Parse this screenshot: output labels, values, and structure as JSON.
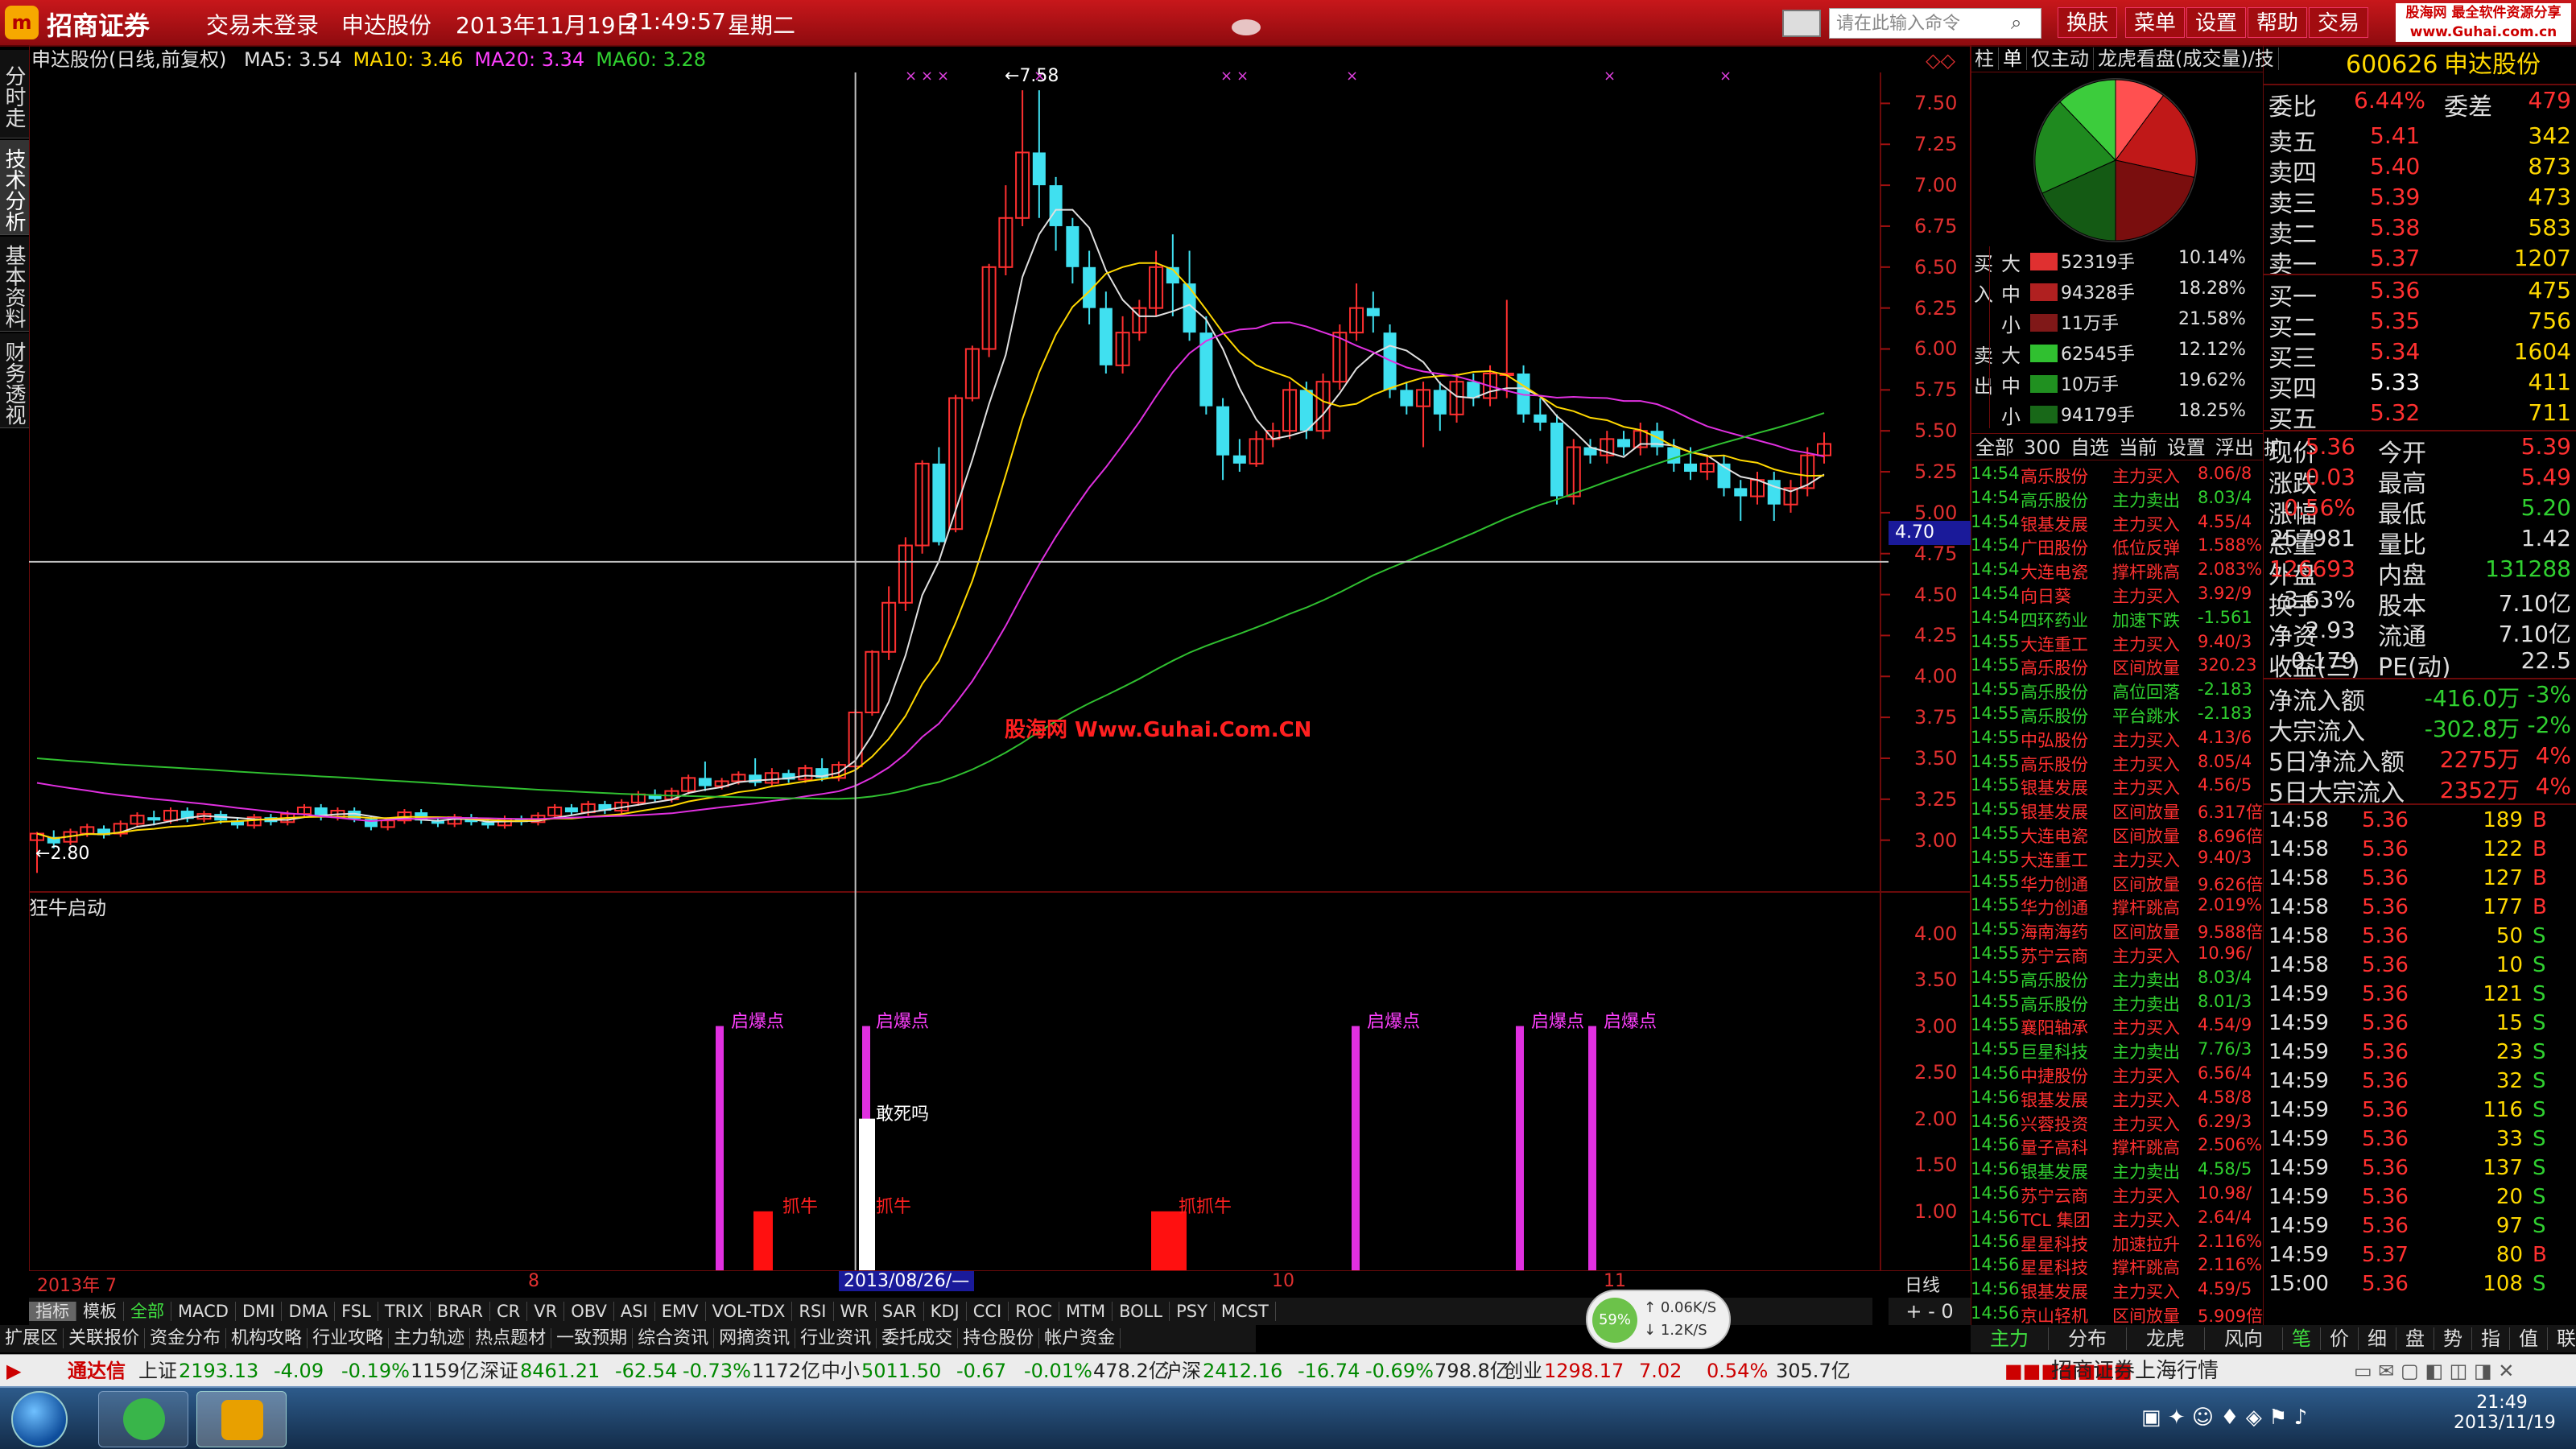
{
  "app": {
    "brand": "招商证券",
    "login_status": "交易未登录",
    "stock_name": "申达股份",
    "date": "2013年11月19日",
    "time": "21:49:57",
    "weekday": "星期二",
    "cmd_placeholder": "请在此输入命令",
    "menus": [
      "换肤",
      "菜单",
      "设置",
      "帮助",
      "交易"
    ],
    "site_badge_1": "股海网 最全软件资源分享",
    "site_badge_2": "www.Guhai.com.cn"
  },
  "side_tabs": [
    "分时走势",
    "技术分析",
    "基本资料",
    "财务透视"
  ],
  "chart": {
    "title": "申达股份(日线,前复权)",
    "ma_labels": [
      {
        "t": "MA5: 3.54",
        "c": "#e0e0e0"
      },
      {
        "t": "MA10: 3.46",
        "c": "#ffd800"
      },
      {
        "t": "MA20: 3.34",
        "c": "#ff40ff"
      },
      {
        "t": "MA60: 3.28",
        "c": "#30d030"
      }
    ],
    "y_ticks": [
      "7.50",
      "7.25",
      "7.00",
      "6.75",
      "6.50",
      "6.25",
      "6.00",
      "5.75",
      "5.50",
      "5.25",
      "5.00",
      "4.75",
      "4.50",
      "4.25",
      "4.00",
      "3.75",
      "3.50",
      "3.25",
      "3.00"
    ],
    "high_label": "7.58",
    "low_label": "2.80",
    "cursor_price": "4.70",
    "watermark": "股海网 Www.Guhai.Com.CN",
    "x_labels": [
      "2013年 7",
      "8",
      "10",
      "11"
    ],
    "cursor_date": "2013/08/26/—",
    "period": "日线"
  },
  "indicator": {
    "name": "狂牛启动",
    "y_ticks": [
      "4.00",
      "3.50",
      "3.00",
      "2.50",
      "2.00",
      "1.50",
      "1.00"
    ],
    "labels": [
      {
        "t": "启爆点",
        "k": "qbd"
      },
      {
        "t": "启爆点",
        "k": "qbd"
      },
      {
        "t": "启爆点",
        "k": "qbd"
      },
      {
        "t": "启爆点",
        "k": "qbd"
      },
      {
        "t": "启爆点",
        "k": "qbd"
      },
      {
        "t": "抓牛",
        "k": "zn"
      },
      {
        "t": "抓牛",
        "k": "zn"
      },
      {
        "t": "抓抓牛",
        "k": "zn"
      },
      {
        "t": "敢死吗",
        "k": "gsm"
      }
    ]
  },
  "indicator_tabs": [
    "指标",
    "模板",
    "全部",
    "MACD",
    "DMI",
    "DMA",
    "FSL",
    "TRIX",
    "BRAR",
    "CR",
    "VR",
    "OBV",
    "ASI",
    "EMV",
    "VOL-TDX",
    "RSI",
    "WR",
    "SAR",
    "KDJ",
    "CCI",
    "ROC",
    "MTM",
    "BOLL",
    "PSY",
    "MCST"
  ],
  "bottom_tabs": [
    "扩展区",
    "关联报价",
    "资金分布",
    "机构攻略",
    "行业攻略",
    "主力轨迹",
    "热点题材",
    "一致预期",
    "综合资讯",
    "网摘资讯",
    "行业资讯",
    "委托成交",
    "持仓股份",
    "帐户资金"
  ],
  "speed": {
    "pct": "59%",
    "up": "0.06K/S",
    "down": "1.2K/S"
  },
  "fund_panel": {
    "tabs": [
      "柱",
      "单",
      "仅主动",
      "龙虎看盘(成交量)/技"
    ],
    "buy_label": "买入",
    "sell_label": "卖出",
    "rows": [
      {
        "g": "买",
        "s": "大",
        "v": "52319手",
        "p": "10.14%",
        "c": "#e03030"
      },
      {
        "g": "入",
        "s": "中",
        "v": "94328手",
        "p": "18.28%",
        "c": "#b02020"
      },
      {
        "g": "",
        "s": "小",
        "v": "11万手",
        "p": "21.58%",
        "c": "#801818"
      },
      {
        "g": "卖",
        "s": "大",
        "v": "62545手",
        "p": "12.12%",
        "c": "#30c030"
      },
      {
        "g": "出",
        "s": "中",
        "v": "10万手",
        "p": "19.62%",
        "c": "#209020"
      },
      {
        "g": "",
        "s": "小",
        "v": "94179手",
        "p": "18.25%",
        "c": "#186818"
      }
    ]
  },
  "pie": {
    "slices": [
      {
        "name": "买大",
        "pct": 10.14,
        "color": "#ff5050"
      },
      {
        "name": "买中",
        "pct": 18.28,
        "color": "#c01818"
      },
      {
        "name": "买小",
        "pct": 21.58,
        "color": "#7a0e0e"
      },
      {
        "name": "卖小",
        "pct": 18.25,
        "color": "#145a14"
      },
      {
        "name": "卖中",
        "pct": 19.62,
        "color": "#1f8a1f"
      },
      {
        "name": "卖大",
        "pct": 12.12,
        "color": "#3ccc3c"
      }
    ]
  },
  "news_tabs": [
    "全部",
    "300",
    "自选",
    "当前",
    "设置",
    "浮出",
    "扩"
  ],
  "news": [
    [
      "14:54",
      "高乐股份",
      "主力买入",
      "8.06/8"
    ],
    [
      "14:54",
      "高乐股份",
      "主力卖出",
      "8.03/4"
    ],
    [
      "14:54",
      "银基发展",
      "主力买入",
      "4.55/4"
    ],
    [
      "14:54",
      "广田股份",
      "低位反弹",
      "1.588%"
    ],
    [
      "14:54",
      "大连电瓷",
      "撑杆跳高",
      "2.083%"
    ],
    [
      "14:54",
      "向日葵",
      "主力买入",
      "3.92/9"
    ],
    [
      "14:54",
      "四环药业",
      "加速下跌",
      "-1.561"
    ],
    [
      "14:55",
      "大连重工",
      "主力买入",
      "9.40/3"
    ],
    [
      "14:55",
      "高乐股份",
      "区间放量",
      "320.23"
    ],
    [
      "14:55",
      "高乐股份",
      "高位回落",
      "-2.183"
    ],
    [
      "14:55",
      "高乐股份",
      "平台跳水",
      "-2.183"
    ],
    [
      "14:55",
      "中弘股份",
      "主力买入",
      "4.13/6"
    ],
    [
      "14:55",
      "高乐股份",
      "主力买入",
      "8.05/4"
    ],
    [
      "14:55",
      "银基发展",
      "主力买入",
      "4.56/5"
    ],
    [
      "14:55",
      "银基发展",
      "区间放量",
      "6.317倍"
    ],
    [
      "14:55",
      "大连电瓷",
      "区间放量",
      "8.696倍"
    ],
    [
      "14:55",
      "大连重工",
      "主力买入",
      "9.40/3"
    ],
    [
      "14:55",
      "华力创通",
      "区间放量",
      "9.626倍"
    ],
    [
      "14:55",
      "华力创通",
      "撑杆跳高",
      "2.019%"
    ],
    [
      "14:55",
      "海南海药",
      "区间放量",
      "9.588倍"
    ],
    [
      "14:55",
      "苏宁云商",
      "主力买入",
      "10.96/"
    ],
    [
      "14:55",
      "高乐股份",
      "主力卖出",
      "8.03/4"
    ],
    [
      "14:55",
      "高乐股份",
      "主力卖出",
      "8.01/3"
    ],
    [
      "14:55",
      "襄阳轴承",
      "主力买入",
      "4.54/9"
    ],
    [
      "14:55",
      "巨星科技",
      "主力卖出",
      "7.76/3"
    ],
    [
      "14:56",
      "中捷股份",
      "主力买入",
      "6.56/4"
    ],
    [
      "14:56",
      "银基发展",
      "主力买入",
      "4.58/8"
    ],
    [
      "14:56",
      "兴蓉投资",
      "主力买入",
      "6.29/3"
    ],
    [
      "14:56",
      "量子高科",
      "撑杆跳高",
      "2.506%"
    ],
    [
      "14:56",
      "银基发展",
      "主力卖出",
      "4.58/5"
    ],
    [
      "14:56",
      "苏宁云商",
      "主力买入",
      "10.98/"
    ],
    [
      "14:56",
      "TCL 集团",
      "主力买入",
      "2.64/4"
    ],
    [
      "14:56",
      "星星科技",
      "加速拉升",
      "2.116%"
    ],
    [
      "14:56",
      "星星科技",
      "撑杆跳高",
      "2.116%"
    ],
    [
      "14:56",
      "银基发展",
      "主力买入",
      "4.59/5"
    ],
    [
      "14:56",
      "京山轻机",
      "区间放量",
      "5.909倍"
    ]
  ],
  "quote": {
    "code": "600626",
    "name": "申达股份",
    "weibi_label": "委比",
    "weibi": "6.44%",
    "weicha_label": "委差",
    "weicha": "479",
    "sells": [
      {
        "l": "卖五",
        "p": "5.41",
        "v": "342"
      },
      {
        "l": "卖四",
        "p": "5.40",
        "v": "873"
      },
      {
        "l": "卖三",
        "p": "5.39",
        "v": "473"
      },
      {
        "l": "卖二",
        "p": "5.38",
        "v": "583"
      },
      {
        "l": "卖一",
        "p": "5.37",
        "v": "1207"
      }
    ],
    "buys": [
      {
        "l": "买一",
        "p": "5.36",
        "v": "475"
      },
      {
        "l": "买二",
        "p": "5.35",
        "v": "756"
      },
      {
        "l": "买三",
        "p": "5.34",
        "v": "1604"
      },
      {
        "l": "买四",
        "p": "5.33",
        "v": "411"
      },
      {
        "l": "买五",
        "p": "5.32",
        "v": "711"
      }
    ],
    "stats": [
      {
        "a": "现价",
        "b": "5.36",
        "c": "今开",
        "d": "5.39"
      },
      {
        "a": "涨跌",
        "b": "0.03",
        "c": "最高",
        "d": "5.49"
      },
      {
        "a": "涨幅",
        "b": "0.56%",
        "c": "最低",
        "d": "5.20"
      },
      {
        "a": "总量",
        "b": "257981",
        "c": "量比",
        "d": "1.42"
      },
      {
        "a": "外盘",
        "b": "126693",
        "c": "内盘",
        "d": "131288"
      },
      {
        "a": "换手",
        "b": "3.63%",
        "c": "股本",
        "d": "7.10亿"
      },
      {
        "a": "净资",
        "b": "2.93",
        "c": "流通",
        "d": "7.10亿"
      },
      {
        "a": "收益(三)",
        "b": "0.179",
        "c": "PE(动)",
        "d": "22.5"
      }
    ],
    "flows": [
      {
        "l": "净流入额",
        "v": "-416.0万",
        "p": "-3%"
      },
      {
        "l": "大宗流入",
        "v": "-302.8万",
        "p": "-2%"
      },
      {
        "l": "5日净流入额",
        "v": "2275万",
        "p": "4%"
      },
      {
        "l": "5日大宗流入",
        "v": "2352万",
        "p": "4%"
      }
    ]
  },
  "ticks": [
    [
      "14:58",
      "5.36",
      "189",
      "B"
    ],
    [
      "14:58",
      "5.36",
      "122",
      "B"
    ],
    [
      "14:58",
      "5.36",
      "127",
      "B"
    ],
    [
      "14:58",
      "5.36",
      "177",
      "B"
    ],
    [
      "14:58",
      "5.36",
      "50",
      "S"
    ],
    [
      "14:58",
      "5.36",
      "10",
      "S"
    ],
    [
      "14:59",
      "5.36",
      "121",
      "S"
    ],
    [
      "14:59",
      "5.36",
      "15",
      "S"
    ],
    [
      "14:59",
      "5.36",
      "23",
      "S"
    ],
    [
      "14:59",
      "5.36",
      "32",
      "S"
    ],
    [
      "14:59",
      "5.36",
      "116",
      "S"
    ],
    [
      "14:59",
      "5.36",
      "33",
      "S"
    ],
    [
      "14:59",
      "5.36",
      "137",
      "S"
    ],
    [
      "14:59",
      "5.36",
      "20",
      "S"
    ],
    [
      "14:59",
      "5.36",
      "97",
      "S"
    ],
    [
      "14:59",
      "5.37",
      "80",
      "B"
    ],
    [
      "15:00",
      "5.36",
      "108",
      "S"
    ]
  ],
  "right_bottom_tabs": [
    "主力",
    "分布",
    "龙虎",
    "风向",
    "笔",
    "价",
    "细",
    "盘",
    "势",
    "指",
    "值",
    "联"
  ],
  "indices": {
    "app": "通达信",
    "items": [
      {
        "n": "上证",
        "v": "2193.13",
        "c": "-4.09",
        "p": "-0.19%",
        "a": "1159亿"
      },
      {
        "n": "深证",
        "v": "8461.21",
        "c": "-62.54",
        "p": "-0.73%",
        "a": "1172亿"
      },
      {
        "n": "中小",
        "v": "5011.50",
        "c": "-0.67",
        "p": "-0.01%",
        "a": "478.2亿"
      },
      {
        "n": "沪深",
        "v": "2412.16",
        "c": "-16.74",
        "p": "-0.69%",
        "a": "798.8亿"
      },
      {
        "n": "创业",
        "v": "1298.17",
        "c": "7.02",
        "p": "0.54%",
        "a": "305.7亿"
      }
    ],
    "broker": "招商证券上海行情"
  },
  "taskbar": {
    "time": "21:49",
    "date": "2013/11/19"
  },
  "candles": [
    [
      3.0,
      3.04,
      2.8,
      3.05
    ],
    [
      3.02,
      2.98,
      2.95,
      3.06
    ],
    [
      2.99,
      3.05,
      2.97,
      3.07
    ],
    [
      3.04,
      3.08,
      3.02,
      3.1
    ],
    [
      3.07,
      3.03,
      3.01,
      3.09
    ],
    [
      3.04,
      3.1,
      3.02,
      3.12
    ],
    [
      3.1,
      3.15,
      3.08,
      3.17
    ],
    [
      3.14,
      3.12,
      3.09,
      3.18
    ],
    [
      3.12,
      3.18,
      3.1,
      3.2
    ],
    [
      3.18,
      3.13,
      3.11,
      3.2
    ],
    [
      3.13,
      3.16,
      3.11,
      3.18
    ],
    [
      3.16,
      3.12,
      3.1,
      3.18
    ],
    [
      3.12,
      3.09,
      3.07,
      3.14
    ],
    [
      3.09,
      3.14,
      3.07,
      3.16
    ],
    [
      3.14,
      3.11,
      3.09,
      3.16
    ],
    [
      3.11,
      3.16,
      3.09,
      3.18
    ],
    [
      3.16,
      3.2,
      3.14,
      3.22
    ],
    [
      3.2,
      3.14,
      3.12,
      3.22
    ],
    [
      3.14,
      3.18,
      3.12,
      3.2
    ],
    [
      3.18,
      3.13,
      3.11,
      3.2
    ],
    [
      3.13,
      3.08,
      3.06,
      3.15
    ],
    [
      3.08,
      3.12,
      3.06,
      3.14
    ],
    [
      3.12,
      3.17,
      3.1,
      3.19
    ],
    [
      3.17,
      3.12,
      3.1,
      3.19
    ],
    [
      3.12,
      3.1,
      3.08,
      3.14
    ],
    [
      3.1,
      3.14,
      3.08,
      3.16
    ],
    [
      3.14,
      3.11,
      3.09,
      3.16
    ],
    [
      3.11,
      3.09,
      3.07,
      3.13
    ],
    [
      3.09,
      3.13,
      3.07,
      3.15
    ],
    [
      3.13,
      3.11,
      3.09,
      3.15
    ],
    [
      3.11,
      3.15,
      3.09,
      3.17
    ],
    [
      3.15,
      3.2,
      3.13,
      3.22
    ],
    [
      3.2,
      3.17,
      3.15,
      3.22
    ],
    [
      3.17,
      3.22,
      3.15,
      3.24
    ],
    [
      3.22,
      3.18,
      3.16,
      3.24
    ],
    [
      3.18,
      3.23,
      3.16,
      3.25
    ],
    [
      3.23,
      3.28,
      3.21,
      3.3
    ],
    [
      3.28,
      3.25,
      3.23,
      3.31
    ],
    [
      3.25,
      3.3,
      3.23,
      3.32
    ],
    [
      3.3,
      3.38,
      3.28,
      3.4
    ],
    [
      3.38,
      3.33,
      3.3,
      3.48
    ],
    [
      3.33,
      3.36,
      3.31,
      3.38
    ],
    [
      3.36,
      3.4,
      3.34,
      3.42
    ],
    [
      3.4,
      3.35,
      3.33,
      3.5
    ],
    [
      3.35,
      3.41,
      3.33,
      3.44
    ],
    [
      3.41,
      3.37,
      3.35,
      3.43
    ],
    [
      3.37,
      3.44,
      3.35,
      3.46
    ],
    [
      3.44,
      3.38,
      3.36,
      3.5
    ],
    [
      3.38,
      3.46,
      3.36,
      3.48
    ],
    [
      3.45,
      3.78,
      3.44,
      3.8
    ],
    [
      3.78,
      4.15,
      3.76,
      4.16
    ],
    [
      4.15,
      4.45,
      4.1,
      4.55
    ],
    [
      4.45,
      4.8,
      4.4,
      4.85
    ],
    [
      4.8,
      5.3,
      4.75,
      5.32
    ],
    [
      5.3,
      4.82,
      4.8,
      5.4
    ],
    [
      4.9,
      5.7,
      4.88,
      5.72
    ],
    [
      5.7,
      6.0,
      5.68,
      6.02
    ],
    [
      6.0,
      6.5,
      5.95,
      6.52
    ],
    [
      6.5,
      6.8,
      6.45,
      7.0
    ],
    [
      6.8,
      7.2,
      6.75,
      7.58
    ],
    [
      7.2,
      7.0,
      6.8,
      7.58
    ],
    [
      7.0,
      6.75,
      6.6,
      7.05
    ],
    [
      6.75,
      6.5,
      6.4,
      6.8
    ],
    [
      6.5,
      6.25,
      6.15,
      6.6
    ],
    [
      6.25,
      5.9,
      5.85,
      6.35
    ],
    [
      5.9,
      6.1,
      5.85,
      6.2
    ],
    [
      6.1,
      6.25,
      6.05,
      6.3
    ],
    [
      6.25,
      6.5,
      6.2,
      6.6
    ],
    [
      6.5,
      6.4,
      6.2,
      6.7
    ],
    [
      6.4,
      6.1,
      6.05,
      6.6
    ],
    [
      6.1,
      5.65,
      5.6,
      6.2
    ],
    [
      5.65,
      5.35,
      5.2,
      5.7
    ],
    [
      5.35,
      5.3,
      5.25,
      5.45
    ],
    [
      5.3,
      5.45,
      5.28,
      5.5
    ],
    [
      5.45,
      5.5,
      5.4,
      5.55
    ],
    [
      5.5,
      5.75,
      5.45,
      5.8
    ],
    [
      5.75,
      5.5,
      5.45,
      5.8
    ],
    [
      5.5,
      5.8,
      5.45,
      5.85
    ],
    [
      5.8,
      6.1,
      5.75,
      6.15
    ],
    [
      6.1,
      6.25,
      6.05,
      6.4
    ],
    [
      6.25,
      6.2,
      6.1,
      6.35
    ],
    [
      6.1,
      5.75,
      5.7,
      6.15
    ],
    [
      5.75,
      5.65,
      5.6,
      5.8
    ],
    [
      5.65,
      5.75,
      5.4,
      5.8
    ],
    [
      5.75,
      5.6,
      5.5,
      5.8
    ],
    [
      5.6,
      5.8,
      5.55,
      5.85
    ],
    [
      5.8,
      5.7,
      5.65,
      5.85
    ],
    [
      5.7,
      5.85,
      5.65,
      5.9
    ],
    [
      5.85,
      5.85,
      5.7,
      6.3
    ],
    [
      5.85,
      5.6,
      5.55,
      5.9
    ],
    [
      5.6,
      5.55,
      5.5,
      5.7
    ],
    [
      5.55,
      5.1,
      5.05,
      5.6
    ],
    [
      5.1,
      5.4,
      5.05,
      5.45
    ],
    [
      5.4,
      5.35,
      5.3,
      5.45
    ],
    [
      5.35,
      5.45,
      5.3,
      5.5
    ],
    [
      5.45,
      5.4,
      5.35,
      5.5
    ],
    [
      5.4,
      5.5,
      5.35,
      5.55
    ],
    [
      5.5,
      5.4,
      5.35,
      5.55
    ],
    [
      5.4,
      5.3,
      5.25,
      5.45
    ],
    [
      5.3,
      5.25,
      5.2,
      5.4
    ],
    [
      5.25,
      5.3,
      5.2,
      5.35
    ],
    [
      5.3,
      5.15,
      5.1,
      5.35
    ],
    [
      5.15,
      5.1,
      4.95,
      5.2
    ],
    [
      5.1,
      5.2,
      5.05,
      5.25
    ],
    [
      5.2,
      5.05,
      4.95,
      5.25
    ],
    [
      5.05,
      5.15,
      5.0,
      5.2
    ],
    [
      5.15,
      5.35,
      5.1,
      5.4
    ],
    [
      5.35,
      5.42,
      5.3,
      5.49
    ]
  ]
}
